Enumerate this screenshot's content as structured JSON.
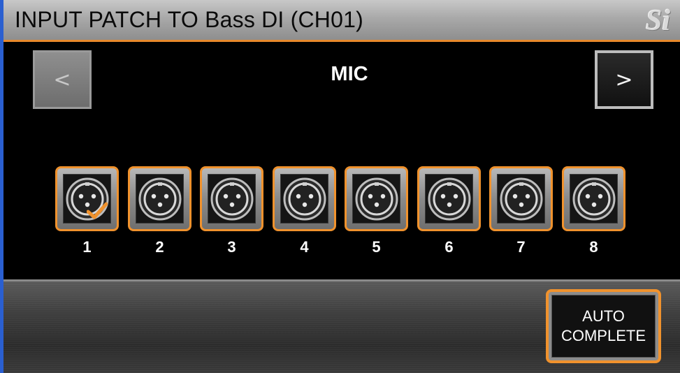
{
  "header": {
    "title": "INPUT PATCH TO Bass DI (CH01)",
    "logo_text": "Si"
  },
  "navigator": {
    "prev_label": "<",
    "next_label": ">",
    "category": "MIC"
  },
  "sockets": [
    {
      "label": "1",
      "selected": true
    },
    {
      "label": "2",
      "selected": false
    },
    {
      "label": "3",
      "selected": false
    },
    {
      "label": "4",
      "selected": false
    },
    {
      "label": "5",
      "selected": false
    },
    {
      "label": "6",
      "selected": false
    },
    {
      "label": "7",
      "selected": false
    },
    {
      "label": "8",
      "selected": false
    }
  ],
  "footer": {
    "auto_line1": "AUTO",
    "auto_line2": "COMPLETE"
  },
  "colors": {
    "accent": "#f0922d",
    "selection_edge": "#2a5fd0"
  },
  "icons": {
    "socket": "xlr-female-connector-icon",
    "selected": "checkmark-icon"
  }
}
